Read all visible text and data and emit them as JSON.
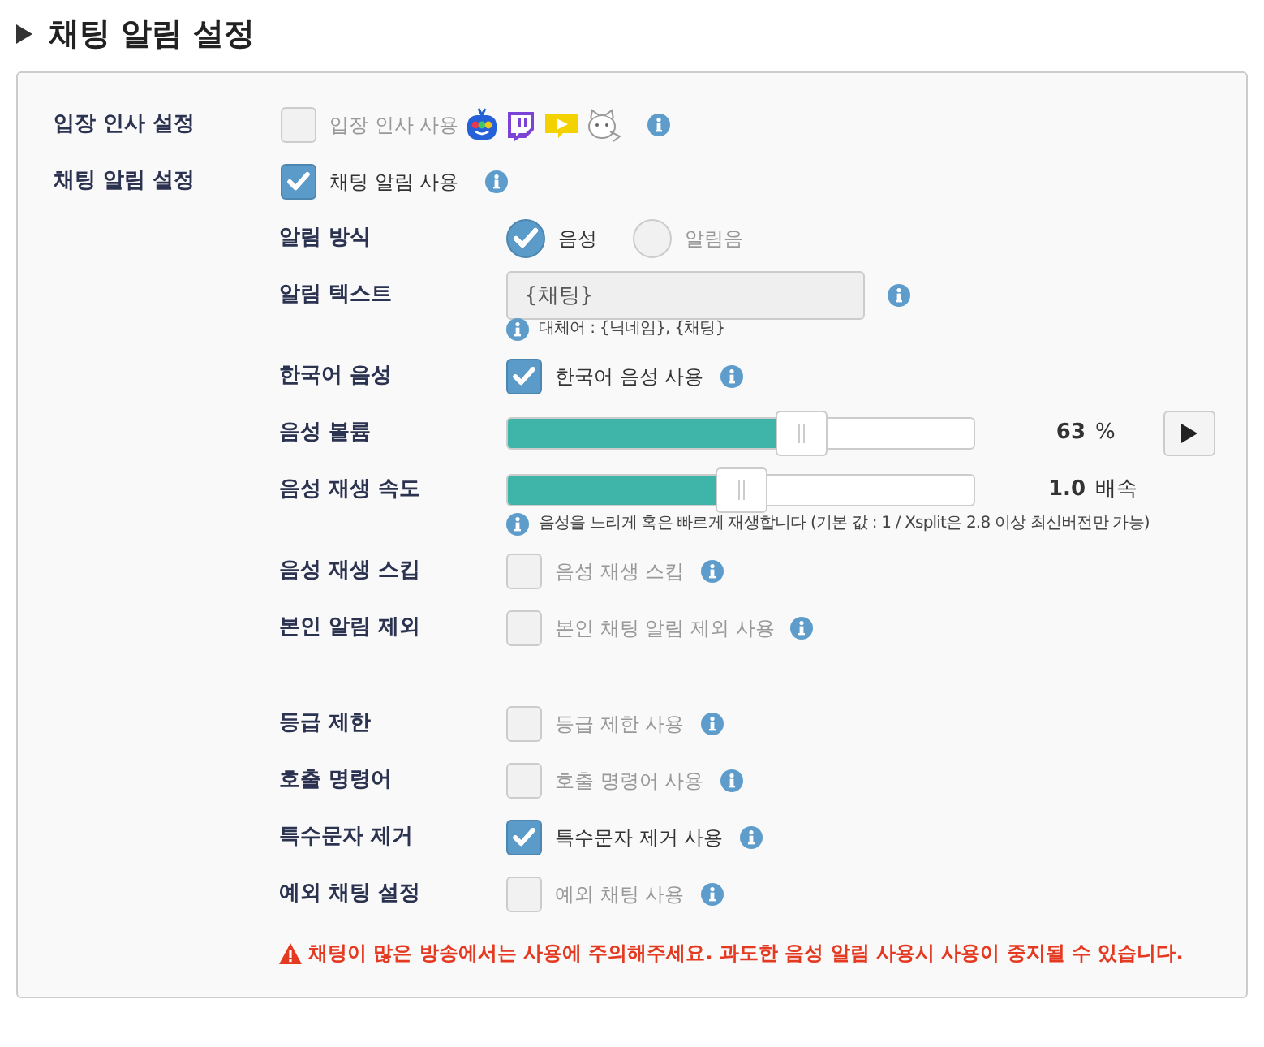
{
  "section_title": "채팅 알림 설정",
  "top_rows": [
    {
      "label": "입장 인사 설정",
      "checkbox_label": "입장 인사 사용",
      "checked": false,
      "platform_icons": true
    },
    {
      "label": "채팅 알림 설정",
      "checkbox_label": "채팅 알림 사용",
      "checked": true,
      "platform_icons": false
    }
  ],
  "settings": [
    {
      "kind": "radio",
      "label": "알림 방식",
      "options": [
        {
          "label": "음성",
          "selected": true
        },
        {
          "label": "알림음",
          "selected": false
        }
      ]
    },
    {
      "kind": "text",
      "label": "알림 텍스트",
      "value": "{채팅}",
      "hint": "대체어 : {닉네임}, {채팅}"
    },
    {
      "kind": "checkbox",
      "label": "한국어 음성",
      "checkbox_label": "한국어 음성 사용",
      "checked": true
    },
    {
      "kind": "slider",
      "label": "음성 볼륨",
      "level": 0.63,
      "reading": "63",
      "unit": "%",
      "play": true
    },
    {
      "kind": "slider",
      "label": "음성 재생 속도",
      "level": 0.5,
      "reading": "1.0",
      "unit": "배속",
      "play": false,
      "hint": "음성을 느리게 혹은 빠르게 재생합니다 (기본 값 : 1 / Xsplit은 2.8 이상 최신버전만 가능)"
    },
    {
      "kind": "checkbox",
      "label": "음성 재생 스킵",
      "checkbox_label": "음성 재생 스킵",
      "checked": false
    },
    {
      "kind": "checkbox",
      "label": "본인 알림 제외",
      "checkbox_label": "본인 채팅 알림 제외 사용",
      "checked": false
    },
    {
      "kind": "spacer"
    },
    {
      "kind": "checkbox",
      "label": "등급 제한",
      "checkbox_label": "등급 제한 사용",
      "checked": false
    },
    {
      "kind": "checkbox",
      "label": "호출 명령어",
      "checkbox_label": "호출 명령어 사용",
      "checked": false
    },
    {
      "kind": "checkbox",
      "label": "특수문자 제거",
      "checkbox_label": "특수문자 제거 사용",
      "checked": true
    },
    {
      "kind": "checkbox",
      "label": "예외 채팅 설정",
      "checkbox_label": "예외 채팅 사용",
      "checked": false
    }
  ],
  "warning": "채팅이 많은 방송에서는 사용에 주의해주세요. 과도한 음성 알림 사용시 사용이 중지될 수 있습니다."
}
